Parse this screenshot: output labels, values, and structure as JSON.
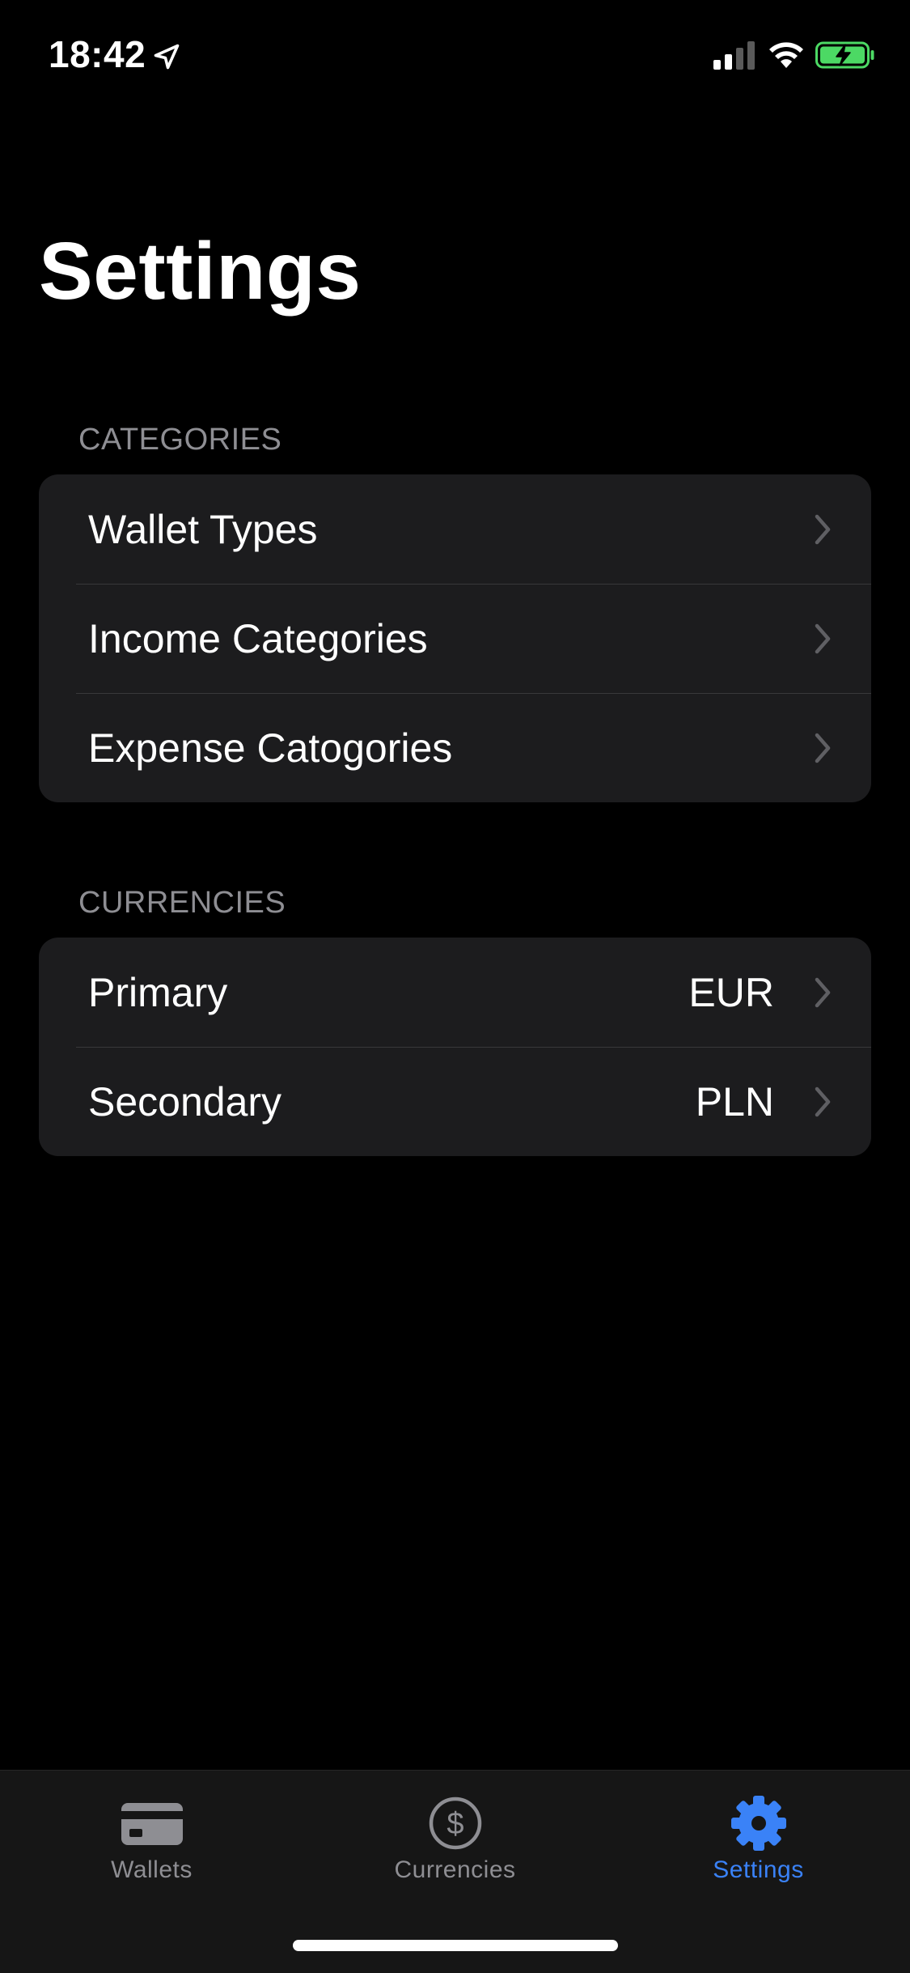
{
  "status_bar": {
    "time": "18:42"
  },
  "title": "Settings",
  "sections": {
    "categories": {
      "header": "CATEGORIES",
      "items": [
        {
          "label": "Wallet Types"
        },
        {
          "label": "Income Categories"
        },
        {
          "label": "Expense Catogories"
        }
      ]
    },
    "currencies": {
      "header": "CURRENCIES",
      "items": [
        {
          "label": "Primary",
          "value": "EUR"
        },
        {
          "label": "Secondary",
          "value": "PLN"
        }
      ]
    }
  },
  "tab_bar": {
    "tabs": [
      {
        "label": "Wallets",
        "icon": "creditcard-icon",
        "active": false
      },
      {
        "label": "Currencies",
        "icon": "dollar-circle-icon",
        "active": false
      },
      {
        "label": "Settings",
        "icon": "gear-icon",
        "active": true
      }
    ]
  },
  "colors": {
    "background": "#000000",
    "group_background": "#1c1c1e",
    "secondary_text": "#8e8e93",
    "accent": "#3a82f7",
    "battery_green": "#4cd964"
  }
}
